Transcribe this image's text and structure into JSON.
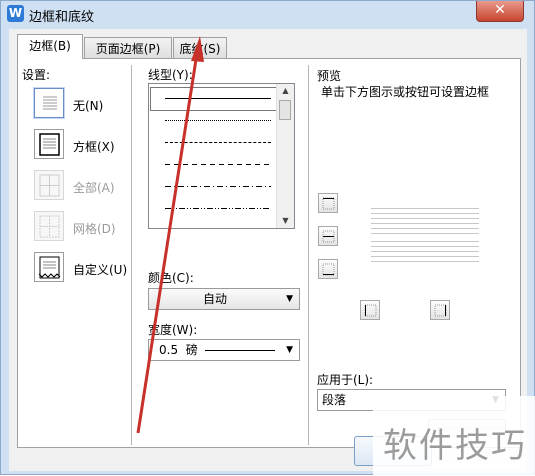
{
  "window": {
    "title": "边框和底纹",
    "app_icon_glyph": "W",
    "close_glyph": "✕"
  },
  "tabs": [
    {
      "label": "边框(B)"
    },
    {
      "label": "页面边框(P)"
    },
    {
      "label": "底纹(S)"
    }
  ],
  "settings": {
    "heading": "设置:",
    "items": [
      {
        "label": "无(N)"
      },
      {
        "label": "方框(X)"
      },
      {
        "label": "全部(A)"
      },
      {
        "label": "网格(D)"
      },
      {
        "label": "自定义(U)"
      }
    ]
  },
  "line_style": {
    "heading": "线型(Y):"
  },
  "color": {
    "heading": "颜色(C):",
    "value": "自动"
  },
  "width": {
    "heading": "宽度(W):",
    "value": "0.5  磅"
  },
  "preview": {
    "heading": "预览",
    "hint": "单击下方图示或按钮可设置边框"
  },
  "apply_to": {
    "heading": "应用于(L):",
    "value": "段落"
  },
  "watermark": {
    "text": "软件技巧"
  },
  "colors": {
    "title_bar": "#cfe0f3",
    "dialog_bg": "#f0f0f0",
    "close_button": "#c7442f",
    "annotation_arrow": "#c8302a"
  }
}
